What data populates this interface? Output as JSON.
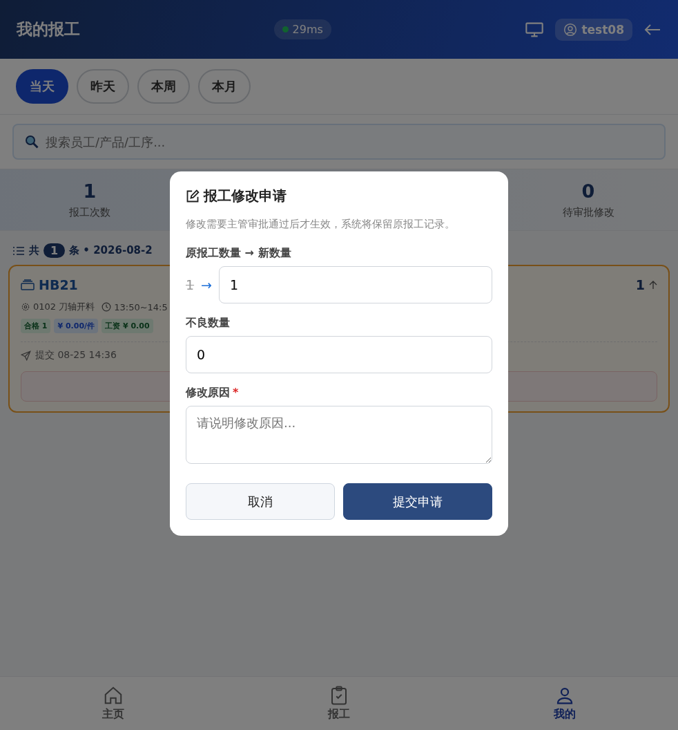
{
  "header": {
    "title": "我的报工",
    "latency": "29ms",
    "username": "test08"
  },
  "range_tabs": [
    {
      "label": "当天",
      "selected": true
    },
    {
      "label": "昨天",
      "selected": false
    },
    {
      "label": "本周",
      "selected": false
    },
    {
      "label": "本月",
      "selected": false
    }
  ],
  "search": {
    "placeholder": "搜索员工/产品/工序..."
  },
  "stats": [
    {
      "value": "1",
      "label": "报工次数"
    },
    {
      "value": "0",
      "label": "待审批修改"
    }
  ],
  "list_header": {
    "prefix": "共",
    "count": "1",
    "suffix": "条 • 2026-08-2"
  },
  "records": [
    {
      "product": "HB21",
      "process": "0102 刀轴开料",
      "time": "13:50~14:5",
      "quantity": "1",
      "submitted": "提交 08-25 14:36",
      "tags": [
        {
          "label": "合格 1",
          "kind": "qualified"
        },
        {
          "label": "¥ 0.00/件",
          "kind": "price"
        },
        {
          "label": "工资 ¥ 0.00",
          "kind": "wage"
        }
      ]
    }
  ],
  "modal": {
    "title": "报工修改申请",
    "description": "修改需要主管审批通过后才生效，系统将保留原报工记录。",
    "quantity": {
      "label": "原报工数量 → 新数量",
      "old_value": "1",
      "arrow": "→",
      "value": "1"
    },
    "defect": {
      "label": "不良数量",
      "value": "0"
    },
    "reason": {
      "label": "修改原因",
      "required": true,
      "required_mark": "*",
      "placeholder": "请说明修改原因..."
    },
    "buttons": [
      {
        "label": "取消",
        "kind": "secondary"
      },
      {
        "label": "提交申请",
        "kind": "primary"
      }
    ]
  },
  "bottom_nav": [
    {
      "label": "主页",
      "kind": "home",
      "selected": false
    },
    {
      "label": "报工",
      "kind": "report",
      "selected": false
    },
    {
      "label": "我的",
      "kind": "profile",
      "selected": true
    }
  ]
}
